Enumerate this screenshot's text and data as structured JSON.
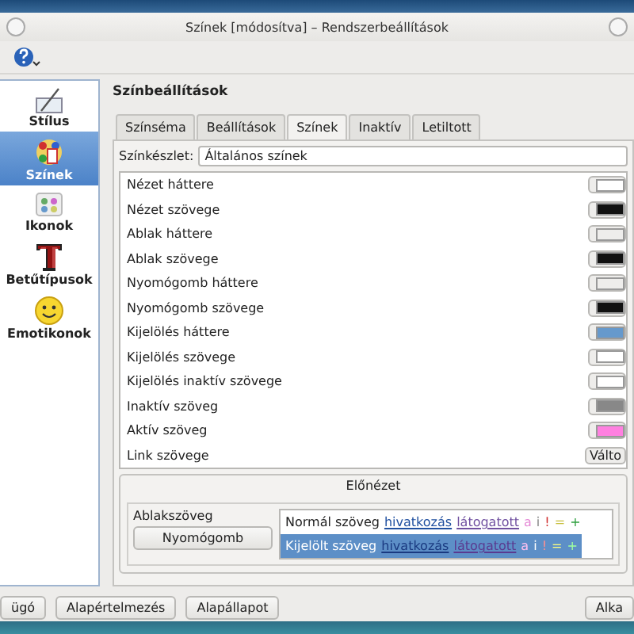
{
  "window": {
    "title": "Színek [módosítva] – Rendszerbeállítások"
  },
  "sidebar": {
    "items": [
      {
        "label": "Stílus",
        "selected": false
      },
      {
        "label": "Színek",
        "selected": true
      },
      {
        "label": "Ikonok",
        "selected": false
      },
      {
        "label": "Betűtípusok",
        "selected": false
      },
      {
        "label": "Emotikonok",
        "selected": false
      }
    ]
  },
  "heading": "Színbeállítások",
  "tabs": [
    {
      "label": "Színséma",
      "selected": false
    },
    {
      "label": "Beállítások",
      "selected": false
    },
    {
      "label": "Színek",
      "selected": true
    },
    {
      "label": "Inaktív",
      "selected": false
    },
    {
      "label": "Letiltott",
      "selected": false
    }
  ],
  "color_set": {
    "label": "Színkészlet:",
    "value": "Általános színek"
  },
  "colors": [
    {
      "name": "Nézet háttere",
      "kind": "swatch",
      "color": "#ffffff"
    },
    {
      "name": "Nézet szövege",
      "kind": "swatch",
      "color": "#111111"
    },
    {
      "name": "Ablak háttere",
      "kind": "swatch",
      "color": "#eeedeb"
    },
    {
      "name": "Ablak szövege",
      "kind": "swatch",
      "color": "#111111"
    },
    {
      "name": "Nyomógomb háttere",
      "kind": "swatch",
      "color": "#eeedeb"
    },
    {
      "name": "Nyomógomb szövege",
      "kind": "swatch",
      "color": "#111111"
    },
    {
      "name": "Kijelölés háttere",
      "kind": "swatch",
      "color": "#6699cc"
    },
    {
      "name": "Kijelölés szövege",
      "kind": "swatch",
      "color": "#ffffff"
    },
    {
      "name": "Kijelölés inaktív szövege",
      "kind": "swatch",
      "color": "#ffffff"
    },
    {
      "name": "Inaktív szöveg",
      "kind": "swatch",
      "color": "#888888"
    },
    {
      "name": "Aktív szöveg",
      "kind": "swatch",
      "color": "#ff80e0"
    },
    {
      "name": "Link szövege",
      "kind": "button",
      "button": "Válto"
    }
  ],
  "preview": {
    "title": "Előnézet",
    "window_text": "Ablakszöveg",
    "button": "Nyomógomb",
    "lines": [
      {
        "selected": false,
        "text": "Normál szöveg",
        "link": "hivatkozás",
        "visited": "látogatott",
        "marks": [
          "a",
          "i",
          "!",
          "=",
          "+"
        ]
      },
      {
        "selected": true,
        "text": "Kijelölt szöveg",
        "link": "hivatkozás",
        "visited": "látogatott",
        "marks": [
          "a",
          "i",
          "!",
          "=",
          "+"
        ]
      }
    ]
  },
  "buttons": [
    "ügó",
    "Alapértelmezés",
    "Alapállapot",
    "Alka"
  ]
}
